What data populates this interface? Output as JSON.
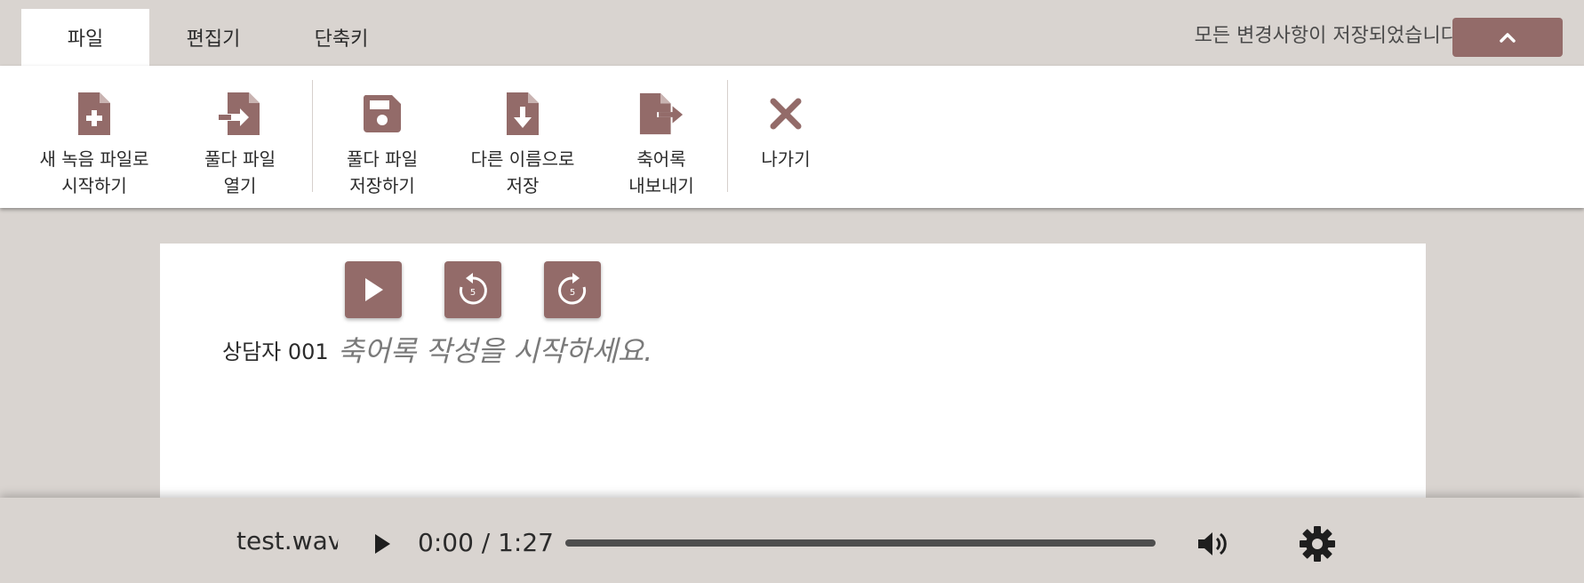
{
  "tabs": {
    "file": "파일",
    "editor": "편집기",
    "shortcut": "단축키"
  },
  "header": {
    "save_status": "모든 변경사항이 저장되었습니다."
  },
  "toolbar": {
    "new_recording": [
      "새 녹음 파일로",
      "시작하기"
    ],
    "open_file": [
      "풀다 파일",
      "열기"
    ],
    "save_file": [
      "풀다 파일",
      "저장하기"
    ],
    "save_as": [
      "다른 이름으로",
      "저장"
    ],
    "export": [
      "축어록",
      "내보내기"
    ],
    "exit": [
      "나가기"
    ]
  },
  "editor": {
    "speaker": "상담자 001",
    "placeholder": "축어록 작성을 시작하세요.",
    "rewind_seconds": "5",
    "forward_seconds": "5"
  },
  "player": {
    "filename": "test.wav",
    "time": "0:00 / 1:27",
    "progress": 0
  },
  "colors": {
    "accent": "#936b69",
    "background": "#d9d4d0",
    "panel": "#ffffff"
  }
}
